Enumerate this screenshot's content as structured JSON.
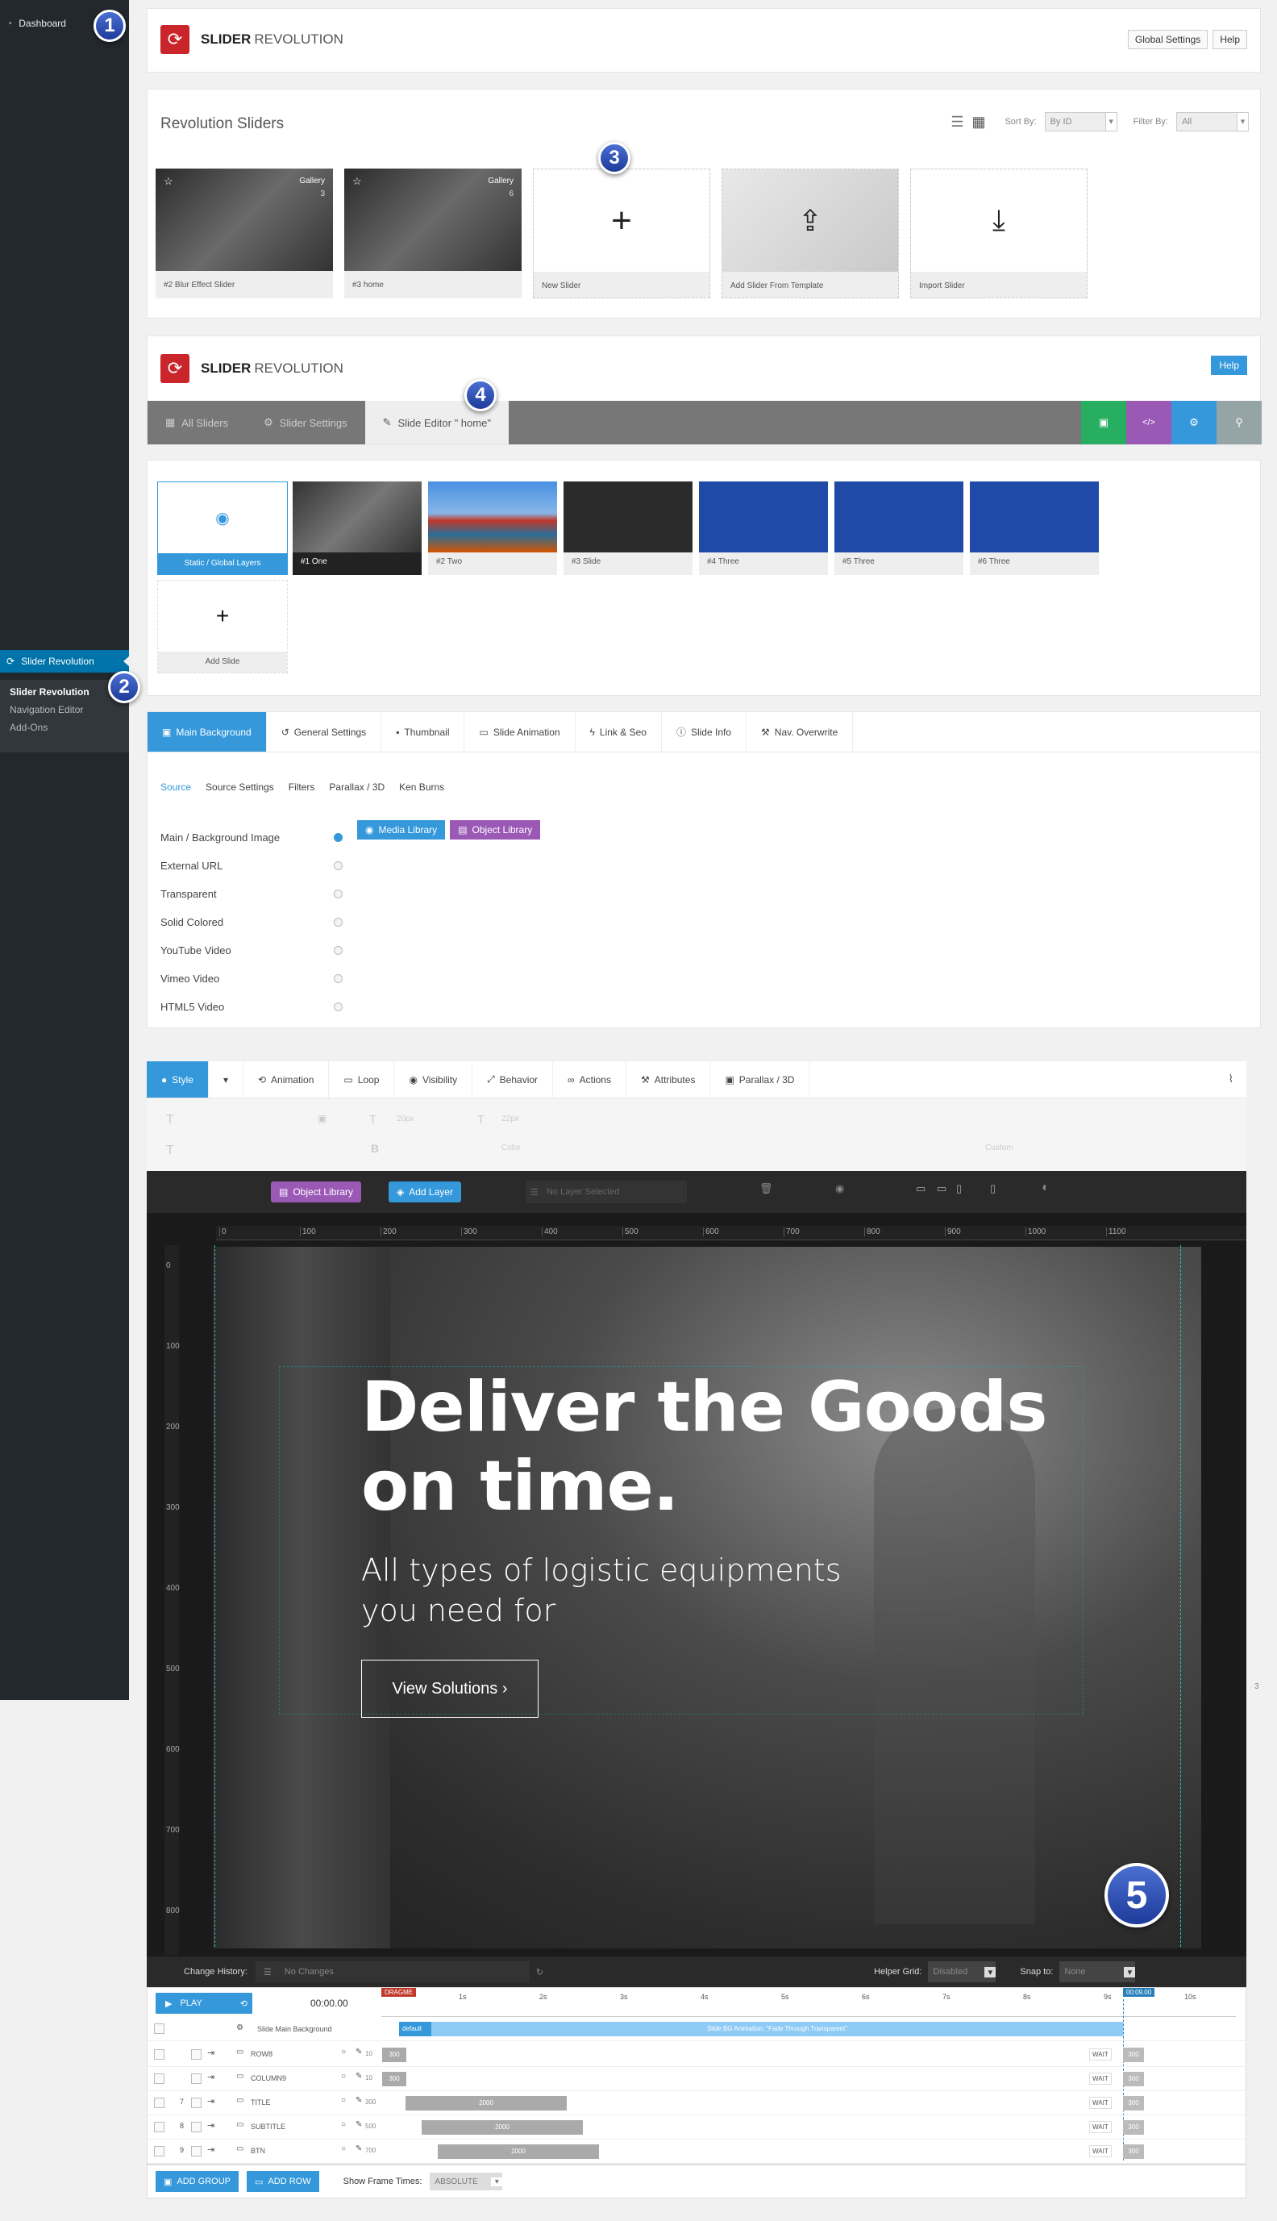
{
  "sidebar": {
    "dashboard": "Dashboard",
    "menu_active": "Slider Revolution",
    "submenu": [
      "Slider Revolution",
      "Navigation Editor",
      "Add-Ons"
    ]
  },
  "badges": [
    "1",
    "2",
    "3",
    "4",
    "5"
  ],
  "brand": {
    "name_bold": "SLIDER",
    "name_light": "REVOLUTION"
  },
  "header1": {
    "global_settings": "Global Settings",
    "help": "Help"
  },
  "sliders": {
    "title": "Revolution Sliders",
    "sort_label": "Sort By:",
    "sort_value": "By ID",
    "filter_label": "Filter By:",
    "filter_value": "All",
    "items": [
      {
        "caption": "#2  Blur Effect Slider",
        "tag": "Gallery",
        "count": "3"
      },
      {
        "caption": "#3  home",
        "tag": "Gallery",
        "count": "6"
      },
      {
        "caption": "New Slider"
      },
      {
        "caption": "Add Slider From Template"
      },
      {
        "caption": "Import Slider"
      }
    ]
  },
  "editor_header": {
    "help": "Help"
  },
  "editor_tabs": [
    "All Sliders",
    "Slider Settings",
    "Slide Editor \" home\""
  ],
  "slides": {
    "static": "Static / Global Layers",
    "items": [
      "#1 One",
      "#2 Two",
      "#3 Slide",
      "#4 Three",
      "#5 Three",
      "#6 Three"
    ],
    "add": "Add Slide"
  },
  "slide_tabs": [
    "Main Background",
    "General Settings",
    "Thumbnail",
    "Slide Animation",
    "Link & Seo",
    "Slide Info",
    "Nav. Overwrite"
  ],
  "source_tabs": [
    "Source",
    "Source Settings",
    "Filters",
    "Parallax / 3D",
    "Ken Burns"
  ],
  "bg_options": [
    "Main / Background Image",
    "External URL",
    "Transparent",
    "Solid Colored",
    "YouTube Video",
    "Vimeo Video",
    "HTML5 Video"
  ],
  "bg_buttons": {
    "media": "Media Library",
    "object": "Object Library"
  },
  "layer_tabs": [
    "Style",
    "Animation",
    "Loop",
    "Visibility",
    "Behavior",
    "Actions",
    "Attributes",
    "Parallax / 3D"
  ],
  "toolbar": {
    "object_library": "Object Library",
    "add_layer": "Add Layer",
    "no_layer": "No Layer Selected",
    "font_size": "20px",
    "line_height": "22px",
    "font_color": "Color",
    "custom": "Custom"
  },
  "ruler": {
    "h": [
      "0",
      "100",
      "200",
      "300",
      "400",
      "500",
      "600",
      "700",
      "800",
      "900",
      "1000",
      "1100"
    ],
    "v": [
      "0",
      "100",
      "200",
      "300",
      "400",
      "500",
      "600",
      "700",
      "800"
    ]
  },
  "canvas": {
    "headline_1": "Deliver the Goods",
    "headline_2": "on time.",
    "sub_1": "All types of logistic equipments",
    "sub_2": "you need for",
    "cta": "View Solutions ›",
    "page_num": "3"
  },
  "history": {
    "label": "Change History:",
    "value": "No Changes",
    "grid_label": "Helper Grid:",
    "grid_value": "Disabled",
    "snap_label": "Snap to:",
    "snap_value": "None"
  },
  "timeline": {
    "play": "PLAY",
    "time": "00:00.00",
    "dragme": "DRAGME",
    "end_time": "00:09.00",
    "ticks": [
      "1s",
      "2s",
      "3s",
      "4s",
      "5s",
      "6s",
      "7s",
      "8s",
      "9s",
      "10s"
    ],
    "bg_row": "Slide Main Background",
    "default": "default",
    "bg_anim": "Slide BG Animation: \"Fade Through Transparent\"",
    "rows": [
      {
        "num": "",
        "name": "ROW8",
        "start": "10",
        "val": "300"
      },
      {
        "num": "",
        "name": "COLUMN9",
        "start": "10",
        "val": "300"
      },
      {
        "num": "7",
        "name": "TITLE",
        "start": "300",
        "val": "2000"
      },
      {
        "num": "8",
        "name": "SUBTITLE",
        "start": "500",
        "val": "2000"
      },
      {
        "num": "9",
        "name": "BTN",
        "start": "700",
        "val": "2000"
      }
    ],
    "wait": "WAIT",
    "wait_val": "300"
  },
  "bottom": {
    "add_group": "ADD GROUP",
    "add_row": "ADD ROW",
    "frame_label": "Show Frame Times:",
    "frame_value": "ABSOLUTE"
  },
  "colors": {
    "accent": "#3498db",
    "purple": "#9b59b6",
    "green": "#27ae60",
    "red": "#c9252b",
    "dark": "#23282d"
  }
}
